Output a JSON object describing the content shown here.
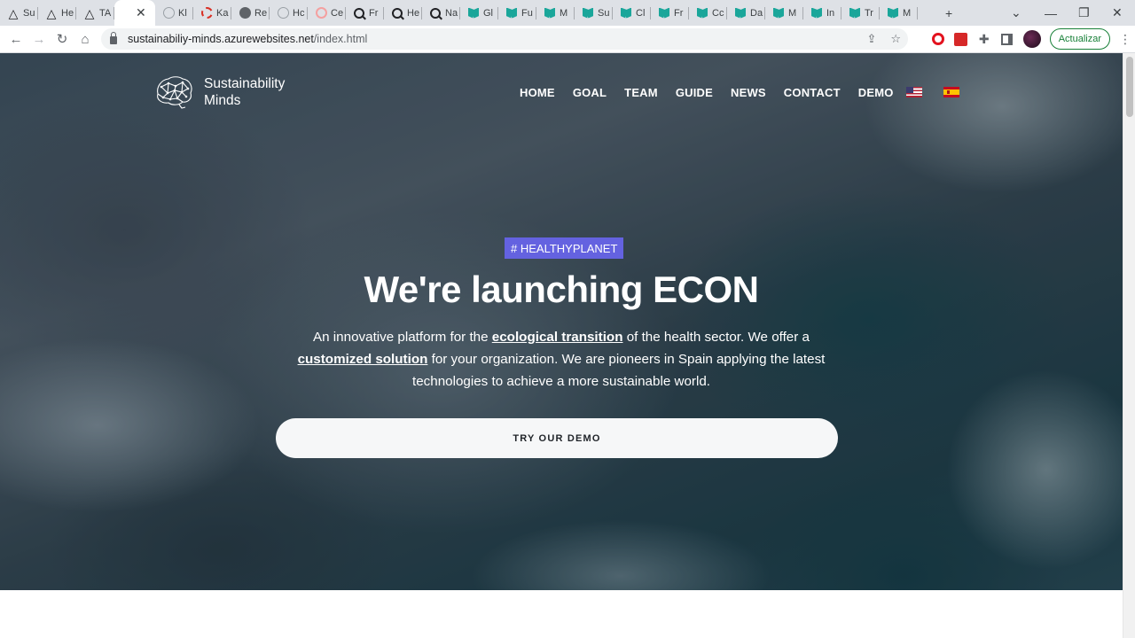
{
  "browser": {
    "tabs": [
      {
        "label": "Su",
        "icon": "triangle-icon"
      },
      {
        "label": "He",
        "icon": "triangle-icon"
      },
      {
        "label": "TA",
        "icon": "triangle-icon"
      },
      {
        "label": "",
        "icon": "close-icon",
        "active": true
      },
      {
        "label": "Kl",
        "icon": "circle-icon"
      },
      {
        "label": "Ka",
        "icon": "red-dashed-circle-icon"
      },
      {
        "label": "Re",
        "icon": "globe-icon"
      },
      {
        "label": "Hc",
        "icon": "circle-icon"
      },
      {
        "label": "Ce",
        "icon": "pink-circle-icon"
      },
      {
        "label": "Fr",
        "icon": "search-icon"
      },
      {
        "label": "He",
        "icon": "search-icon"
      },
      {
        "label": "Na",
        "icon": "search-icon"
      },
      {
        "label": "Gl",
        "icon": "book-icon"
      },
      {
        "label": "Fu",
        "icon": "book-icon"
      },
      {
        "label": "M",
        "icon": "book-icon"
      },
      {
        "label": "Su",
        "icon": "book-icon"
      },
      {
        "label": "Cl",
        "icon": "book-icon"
      },
      {
        "label": "Fr",
        "icon": "book-icon"
      },
      {
        "label": "Cc",
        "icon": "book-icon"
      },
      {
        "label": "Da",
        "icon": "book-icon"
      },
      {
        "label": "M",
        "icon": "book-icon"
      },
      {
        "label": "In",
        "icon": "book-icon"
      },
      {
        "label": "Tr",
        "icon": "book-icon"
      },
      {
        "label": "M",
        "icon": "book-icon"
      }
    ],
    "new_tab_symbol": "+",
    "url_host": "sustainabiliy-minds.azurewebsites.net",
    "url_path": "/index.html",
    "update_label": "Actualizar"
  },
  "site": {
    "logo_line1": "Sustainability",
    "logo_line2": "Minds",
    "nav": [
      "HOME",
      "GOAL",
      "TEAM",
      "GUIDE",
      "NEWS",
      "CONTACT",
      "DEMO"
    ],
    "badge": "# HEALTHYPLANET",
    "headline": "We're launching ECON",
    "lead_part1": "An innovative platform for the ",
    "lead_link1": "ecological transition",
    "lead_part2": " of the health sector. We offer a ",
    "lead_link2": "customized solution",
    "lead_part3": " for your organization. We are pioneers in Spain applying the latest technologies to achieve a more sustainable world.",
    "cta_label": "TRY OUR DEMO"
  },
  "colors": {
    "badge_bg": "#6462e0",
    "update_green": "#188038",
    "tab_strip": "#dee1e6"
  }
}
